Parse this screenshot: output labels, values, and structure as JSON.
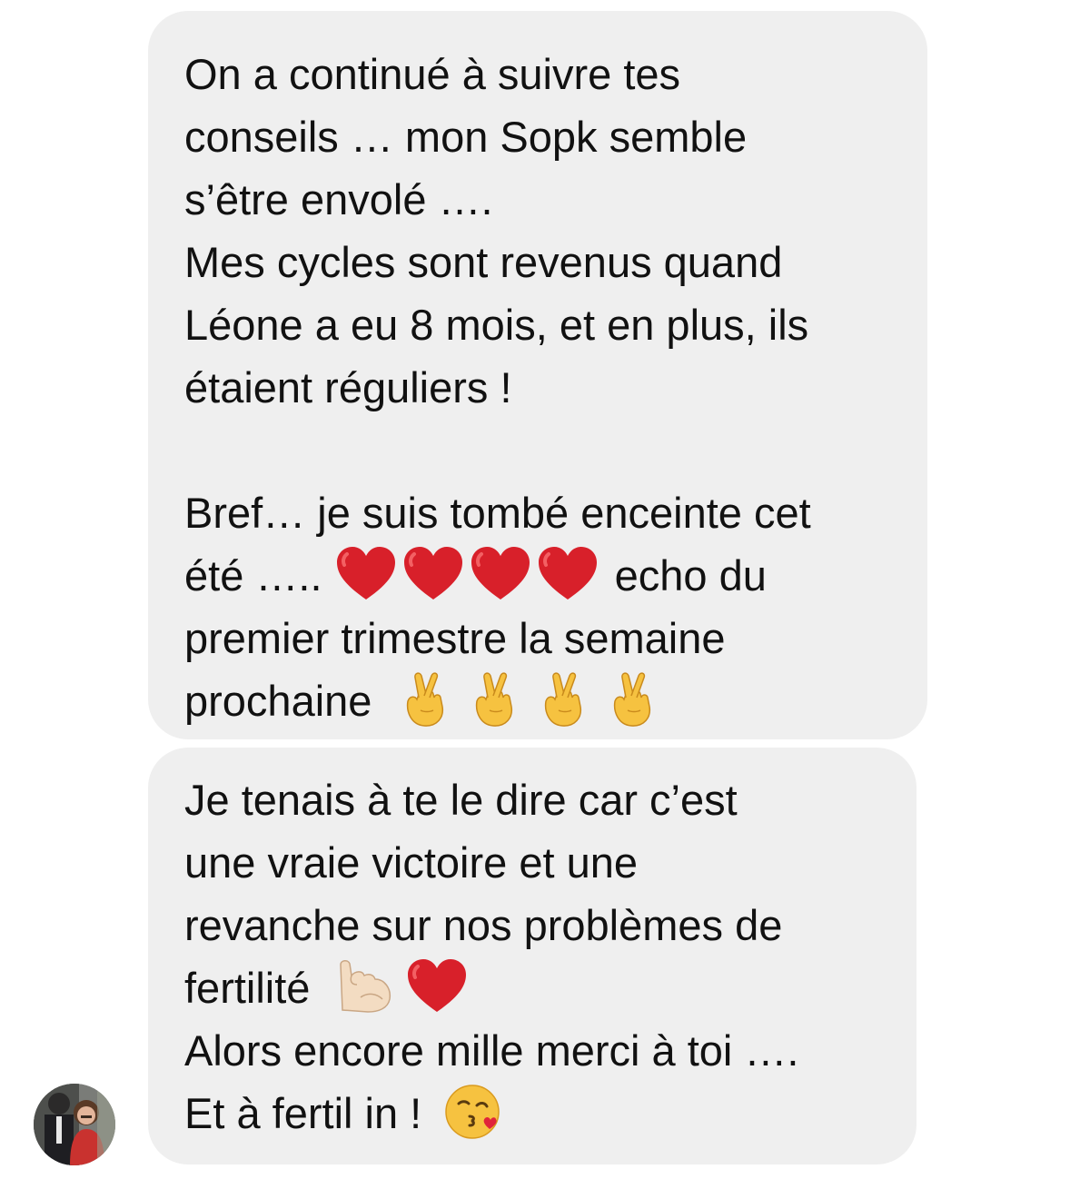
{
  "conversation": {
    "messages": [
      {
        "lines": [
          {
            "text": "On a continué à suivre tes"
          },
          {
            "text": "conseils … mon Sopk semble"
          },
          {
            "text": "s’être envolé …."
          },
          {
            "text": "Mes cycles sont revenus quand"
          },
          {
            "text": "Léone a eu 8 mois, et en plus, ils"
          },
          {
            "text": "étaient réguliers !"
          },
          {
            "text": ""
          },
          {
            "text": "Bref… je suis tombé enceinte cet"
          },
          {
            "before": "été …..",
            "emoji": "red-heart-icon",
            "emoji_count": 4,
            "after": "echo du"
          },
          {
            "text": "premier trimestre la semaine"
          },
          {
            "before": "prochaine",
            "emoji": "crossed-fingers-icon",
            "emoji_count": 4,
            "after": ""
          }
        ]
      },
      {
        "lines": [
          {
            "text": "Je tenais à te le dire car c’est"
          },
          {
            "text": "une vraie victoire et une"
          },
          {
            "text": "revanche sur nos problèmes de"
          },
          {
            "before": "fertilité",
            "emoji_sequence": [
              "flexed-biceps-icon",
              "red-heart-icon"
            ],
            "after": ""
          },
          {
            "text": "Alors encore mille merci à toi …."
          },
          {
            "before": "Et à fertil in !",
            "emoji": "face-blowing-kiss-icon",
            "emoji_count": 1,
            "after": ""
          }
        ]
      }
    ]
  },
  "colors": {
    "bubble_background": "#efefef",
    "text": "#111111",
    "heart": "#d8202a",
    "emoji_yellow": "#f6c240"
  }
}
